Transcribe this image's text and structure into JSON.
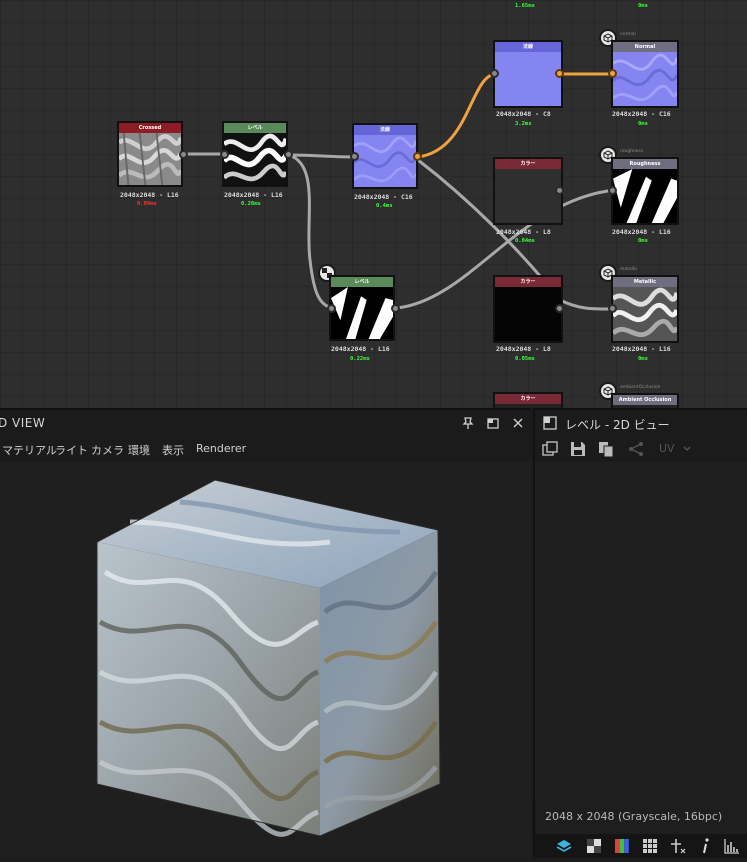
{
  "graph": {
    "top_times": [
      "1.65ms",
      "0ms"
    ],
    "nodes": {
      "crossed": {
        "title": "Crossed",
        "res": "2048x2048 - L16",
        "time": "0.09ms"
      },
      "levels1": {
        "title": "レベル",
        "res": "2048x2048 - L16",
        "time": "0.28ms"
      },
      "normal_mid": {
        "title": "法線",
        "res": "2048x2048 - C16",
        "time": "0.4ms"
      },
      "normal_top": {
        "title": "法線",
        "res": "2048x2048 - C8",
        "time": "3.2ms"
      },
      "out_normal": {
        "title": "Normal",
        "res": "2048x2048 - C16",
        "time": "0ms",
        "label": "normal"
      },
      "uniform1": {
        "title": "カラー",
        "res": "2048x2048 - L8",
        "time": "0.04ms"
      },
      "out_roughness": {
        "title": "Roughness",
        "res": "2048x2048 - L16",
        "time": "0ms",
        "label": "roughness"
      },
      "levels2": {
        "title": "レベル",
        "res": "2048x2048 - L16",
        "time": "0.22ms"
      },
      "uniform2": {
        "title": "カラー",
        "res": "2048x2048 - L8",
        "time": "0.05ms"
      },
      "out_metallic": {
        "title": "Metallic",
        "res": "2048x2048 - L16",
        "time": "0ms",
        "label": "metallic"
      },
      "uniform3": {
        "title": "カラー"
      },
      "out_ao": {
        "title": "Ambient Occlusion",
        "label": "ambientOcclusion"
      }
    }
  },
  "view3d": {
    "title": "D VIEW",
    "menu": [
      "マテリアル",
      "ライト",
      "カメラ",
      "環境",
      "表示",
      "Renderer"
    ]
  },
  "view2d": {
    "title": "レベル - 2D ビュー",
    "uv_label": "UV",
    "info": "2048 x 2048 (Grayscale, 16bpc)"
  },
  "colors": {
    "wire": "#a8a8a8",
    "wire_active": "#f0a33c",
    "normal_blue": "#8585f2",
    "header_red": "#8c1d24",
    "header_green": "#5a8a5a",
    "header_maroon": "#7a2a35",
    "header_output": "#6e6e80",
    "time_green": "#3cff3c",
    "time_red": "#ff3030"
  }
}
